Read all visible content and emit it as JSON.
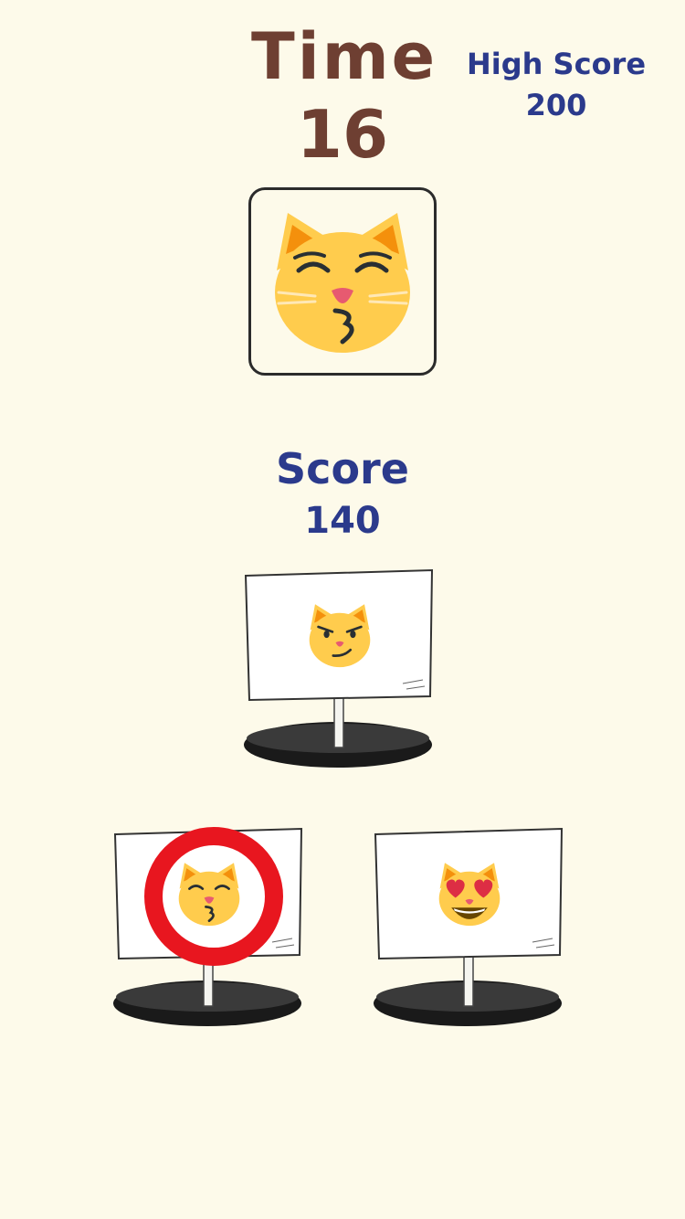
{
  "header": {
    "time_label": "Time",
    "time_value": "16",
    "high_score_label": "High Score",
    "high_score_value": "200"
  },
  "target": {
    "emoji": "kissing-cat-face"
  },
  "score": {
    "label": "Score",
    "value": "140"
  },
  "slots": [
    {
      "emoji": "smirking-cat-face",
      "marked": false
    },
    {
      "emoji": "kissing-cat-face",
      "marked": true
    },
    {
      "emoji": "smiling-cat-heart-eyes",
      "marked": false
    }
  ],
  "colors": {
    "background": "#fdfaea",
    "time_text": "#6e3f32",
    "score_text": "#2b3a8c",
    "cat_face": "#ffcc4d",
    "cat_ear_inner": "#f4900c",
    "marker_ring": "#e8161f",
    "hole": "#1a1a1a"
  }
}
